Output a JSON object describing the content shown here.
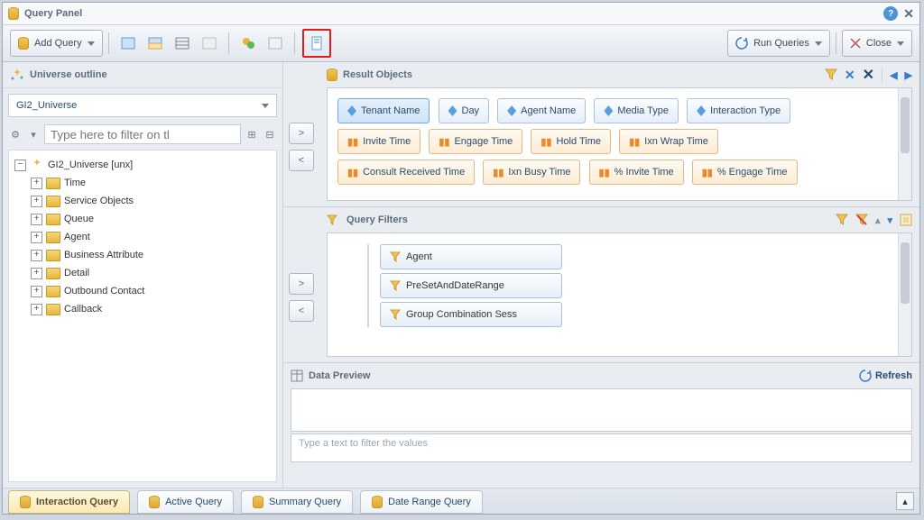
{
  "title": "Query Panel",
  "toolbar": {
    "addQuery": "Add Query",
    "runQueries": "Run Queries",
    "close": "Close"
  },
  "universe": {
    "outlineTitle": "Universe outline",
    "selected": "GI2_Universe",
    "filterPlaceholder": "Type here to filter on tl",
    "rootLabel": "GI2_Universe [unx]",
    "items": [
      "Time",
      "Service Objects",
      "Queue",
      "Agent",
      "Business Attribute",
      "Detail",
      "Outbound Contact",
      "Callback"
    ]
  },
  "resultObjects": {
    "title": "Result Objects",
    "dims": [
      "Tenant Name",
      "Day",
      "Agent Name",
      "Media Type",
      "Interaction Type"
    ],
    "meas": [
      "Invite Time",
      "Engage Time",
      "Hold Time",
      "Ixn Wrap Time"
    ],
    "measRow3": [
      "Consult Received Time",
      "Ixn Busy Time",
      "% Invite Time",
      "% Engage Time"
    ]
  },
  "queryFilters": {
    "title": "Query Filters",
    "items": [
      "Agent",
      "PreSetAndDateRange",
      "Group Combination Sess"
    ]
  },
  "dataPreview": {
    "title": "Data Preview",
    "refresh": "Refresh",
    "filterPlaceholder": "Type a text to filter the values"
  },
  "tabs": [
    "Interaction Query",
    "Active Query",
    "Summary Query",
    "Date Range Query"
  ],
  "glyph": {
    "gt": ">",
    "lt": "<",
    "up": "▴"
  }
}
